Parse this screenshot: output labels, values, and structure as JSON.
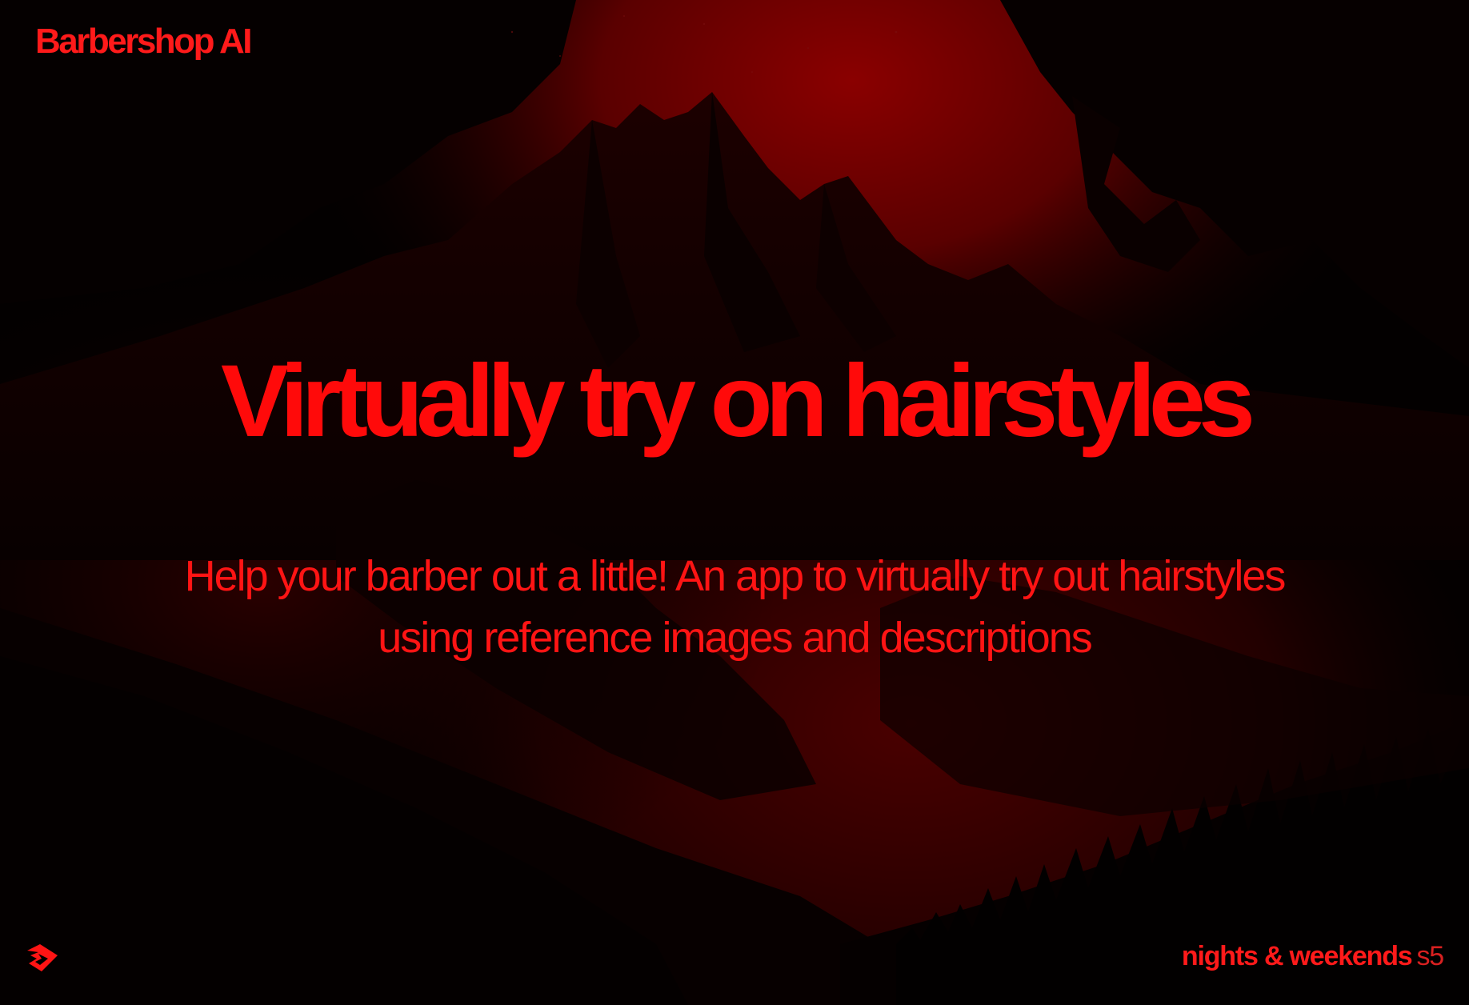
{
  "brand": {
    "name": "Barbershop AI"
  },
  "hero": {
    "headline": "Virtually try on hairstyles",
    "subheadline": "Help your barber out a little! An app to virtually try out hairstyles using reference images and descriptions"
  },
  "footer": {
    "program_label": "nights & weekends",
    "season_label": "s5",
    "logo_icon": "buildspace-logo-icon"
  },
  "colors": {
    "accent": "#ff0a0a",
    "background": "#020000",
    "sky_glow": "#7a0000"
  },
  "background_image": {
    "icon": "mountain-landscape-illustration"
  }
}
